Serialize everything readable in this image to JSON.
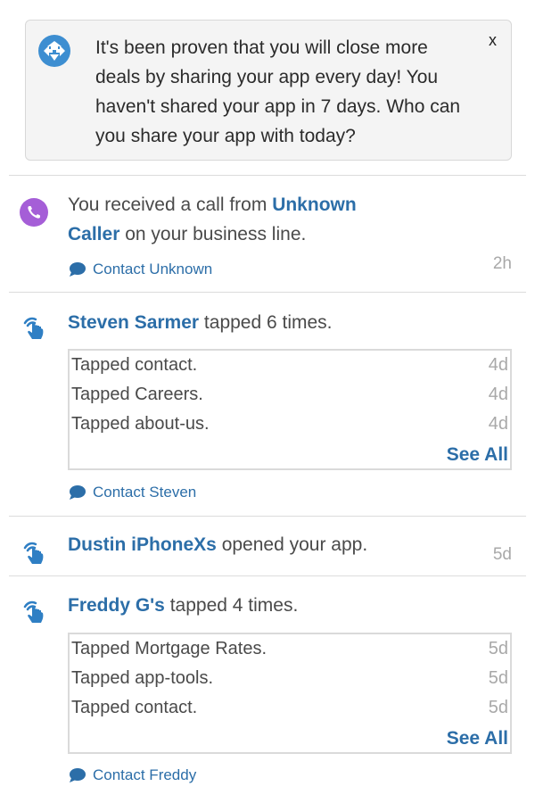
{
  "tip": {
    "message": "It's been proven that you will close more deals by sharing your app every day! You haven't shared your app in 7 days. Who can you share your app with today?",
    "close_label": "x"
  },
  "feed": [
    {
      "type": "call",
      "icon": "phone-icon",
      "prefix": "You received a call from ",
      "name": "Unknown Caller",
      "suffix": " on your business line.",
      "time": "2h",
      "contact_label": "Contact Unknown"
    },
    {
      "type": "taps",
      "icon": "tap-hand-icon",
      "name": "Steven Sarmer",
      "suffix": " tapped 6 times.",
      "activities": [
        {
          "label": "Tapped contact.",
          "ago": "4d"
        },
        {
          "label": "Tapped Careers.",
          "ago": "4d"
        },
        {
          "label": "Tapped about-us.",
          "ago": "4d"
        }
      ],
      "see_all_label": "See All",
      "contact_label": "Contact Steven"
    },
    {
      "type": "open",
      "icon": "tap-hand-icon",
      "name": "Dustin iPhoneXs",
      "suffix": " opened your app.",
      "time": "5d"
    },
    {
      "type": "taps",
      "icon": "tap-hand-icon",
      "name": "Freddy G's",
      "suffix": " tapped 4 times.",
      "activities": [
        {
          "label": "Tapped Mortgage Rates.",
          "ago": "5d"
        },
        {
          "label": "Tapped app-tools.",
          "ago": "5d"
        },
        {
          "label": "Tapped contact.",
          "ago": "5d"
        }
      ],
      "see_all_label": "See All",
      "contact_label": "Contact Freddy"
    }
  ],
  "colors": {
    "link": "#2c6ea8",
    "tip_icon": "#3d8ed1",
    "phone_avatar": "#a55ed7",
    "muted": "#a8a8a8"
  }
}
